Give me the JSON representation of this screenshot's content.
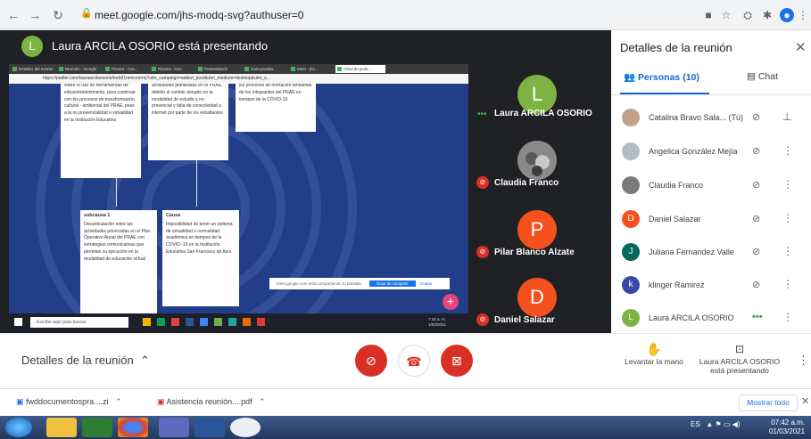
{
  "browser": {
    "url": "meet.google.com/jhs-modq-svg?authuser=0"
  },
  "meet": {
    "presenter_initial": "L",
    "presenter_title": "Laura ARCILA OSORIO está presentando"
  },
  "shared_screen": {
    "tabs": [
      "Detalles del evento",
      "Reunión - Google",
      "Pizarra - Gra...",
      "Pizarra - Gra...",
      "Presentación",
      "Guía prueba...",
      "Meet - jhs...",
      "Árbol de prob..."
    ],
    "url": "https://padlet.com/lauraarcilaosorio/torb91mmcoirrmj?utm_campaign=added_post&utm_medium=desktop&utm_s...",
    "cards": {
      "c1": "sobre el uso de herramientas de edusentretenimiento, para continuar con los procesos de transformación cultural - ambiental del PRAE, pese a la no presencialidad o virtualidad en la Institución Educativa",
      "c2": "actividades planteadas en el PRAE, debido al cambio abrupto en la modalidad de estudio a no presencial y falta de conectividad a internet por parte de los estudiantes",
      "c3": "los procesos de formación ambiental de los integrantes del PRAE en tiempos de la COVID-19",
      "c4_title": "subcausa 1",
      "c4": "Desarticulación entre las actividades priorizadas en el Plan Operativo Anual del PRAE con estrategias comunicativas que permitan su ejecución en la modalidad de educación virtual",
      "c5_title": "Causa",
      "c5": "Imposibilidad de tener un sistema de virtualidad o normalidad académica en tiempos de la COVID -19 en la Institución Educativa San Francisco de Asís."
    },
    "snackbar": {
      "text": "meet.google.com está compartiendo tu pantalla.",
      "stop": "Dejar de compartir",
      "hide": "Ocultar"
    },
    "search_placeholder": "Escribe aquí para buscar",
    "inner_clock": "7:42 a. m. 1/03/2021"
  },
  "tiles": [
    {
      "name": "Laura ARCILA OSORIO",
      "initial": "L",
      "color": "#7cb342"
    },
    {
      "name": "Claudia Franco"
    },
    {
      "name": "Pilar Blanco Alzate",
      "initial": "P",
      "color": "#f4511e"
    },
    {
      "name": "Daniel Salazar",
      "initial": "D",
      "color": "#f4511e"
    }
  ],
  "panel": {
    "title": "Detalles de la reunión",
    "tab_people": "Personas (10)",
    "tab_chat": "Chat",
    "participants": [
      {
        "name": "Catalina Bravo Sala...  (Tú)",
        "initial": "",
        "color": "#c2a38a"
      },
      {
        "name": "Angelica González Mejía",
        "initial": "",
        "color": "#b0bec5"
      },
      {
        "name": "Claudia Franco",
        "initial": "",
        "color": "#7a7a7a"
      },
      {
        "name": "Daniel Salazar",
        "initial": "D",
        "color": "#f4511e"
      },
      {
        "name": "Juliana Fernandez Valle",
        "initial": "J",
        "color": "#00695c"
      },
      {
        "name": "klinger Ramirez",
        "initial": "k",
        "color": "#3949ab"
      },
      {
        "name": "Laura ARCILA OSORIO",
        "initial": "L",
        "color": "#7cb342"
      }
    ]
  },
  "bottombar": {
    "details": "Detalles de la reunión",
    "raise_hand": "Levantar la mano",
    "presenting_name": "Laura ARCILA OSORIO",
    "presenting_label": "está presentando"
  },
  "downloads": {
    "file1": "fwddocumentospra....zi",
    "file2": "Asistencia reunión....pdf",
    "show_all": "Mostrar todo"
  },
  "taskbar": {
    "lang": "ES",
    "time": "07:42 a.m.",
    "date": "01/03/2021"
  },
  "colors": {
    "meet_dark": "#202124",
    "hangup": "#ffffff",
    "mute_red": "#d93025",
    "accent_blue": "#1967d2"
  }
}
